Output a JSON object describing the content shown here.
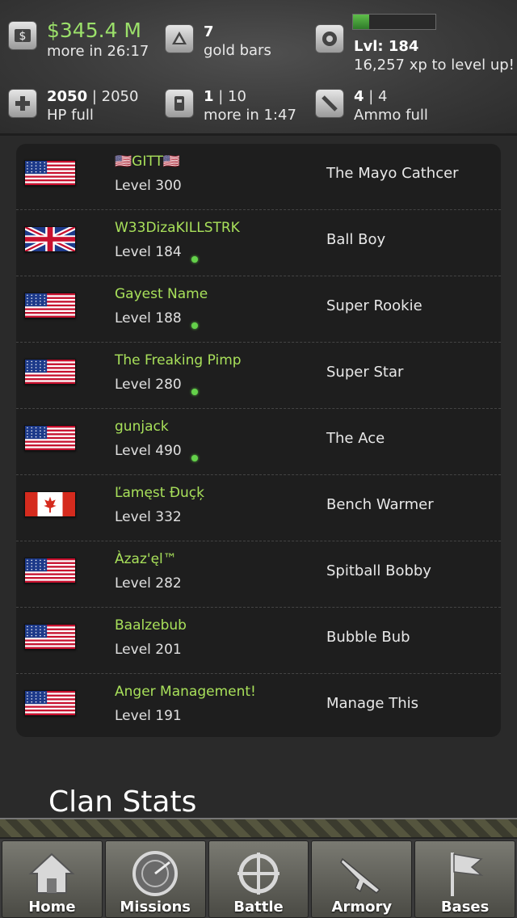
{
  "header": {
    "money": {
      "value": "$345.4 M",
      "sub": "more in 26:17",
      "icon": "dollar-icon"
    },
    "gold": {
      "value": "7",
      "sub": "gold bars",
      "icon": "gold-bars-icon"
    },
    "level": {
      "value": "Lvl: 184",
      "sub": "16,257 xp to level up!",
      "icon": "gear-badge-icon",
      "xp_progress": 0.2
    },
    "hp": {
      "value_bold": "2050",
      "value_rest": " | 2050",
      "sub": "HP full",
      "icon": "medical-cross-icon"
    },
    "energy": {
      "value_bold": "1",
      "value_rest": " | 10",
      "sub": "more in 1:47",
      "icon": "energy-canister-icon"
    },
    "ammo": {
      "value_bold": "4",
      "value_rest": " | 4",
      "sub": "Ammo full",
      "icon": "ammo-icon"
    }
  },
  "players": [
    {
      "flag": "us",
      "name": "🇺🇸GITT🇺🇸",
      "level": "Level 300",
      "online": false,
      "title": "The Mayo Cathcer"
    },
    {
      "flag": "uk",
      "name": "W33DizaKILLSTRK",
      "level": "Level 184",
      "online": true,
      "title": "Ball Boy"
    },
    {
      "flag": "us",
      "name": "Gayest Name",
      "level": "Level 188",
      "online": true,
      "title": "Super Rookie"
    },
    {
      "flag": "us",
      "name": "The Freaking Pimp",
      "level": "Level 280",
      "online": true,
      "title": "Super Star"
    },
    {
      "flag": "us",
      "name": "gunjack",
      "level": "Level 490",
      "online": true,
      "title": "The Ace"
    },
    {
      "flag": "ca",
      "name": "Ľamęst Đuçķ",
      "level": "Level 332",
      "online": false,
      "title": "Bench Warmer"
    },
    {
      "flag": "us",
      "name": "Àzaz'ęl™",
      "level": "Level 282",
      "online": false,
      "title": "Spitball Bobby"
    },
    {
      "flag": "us",
      "name": "Baalzebub",
      "level": "Level 201",
      "online": false,
      "title": "Bubble Bub"
    },
    {
      "flag": "us",
      "name": "Anger Management!",
      "level": "Level 191",
      "online": false,
      "title": "Manage This"
    }
  ],
  "section_title": "Clan Stats",
  "nav": [
    {
      "label": "Home",
      "icon": "home-icon"
    },
    {
      "label": "Missions",
      "icon": "radar-icon"
    },
    {
      "label": "Battle",
      "icon": "crosshair-icon"
    },
    {
      "label": "Armory",
      "icon": "rifle-icon"
    },
    {
      "label": "Bases",
      "icon": "flag-icon"
    }
  ],
  "colors": {
    "accent_green": "#a8e05a",
    "money_green": "#9be06a",
    "online_dot": "#64d24a"
  }
}
